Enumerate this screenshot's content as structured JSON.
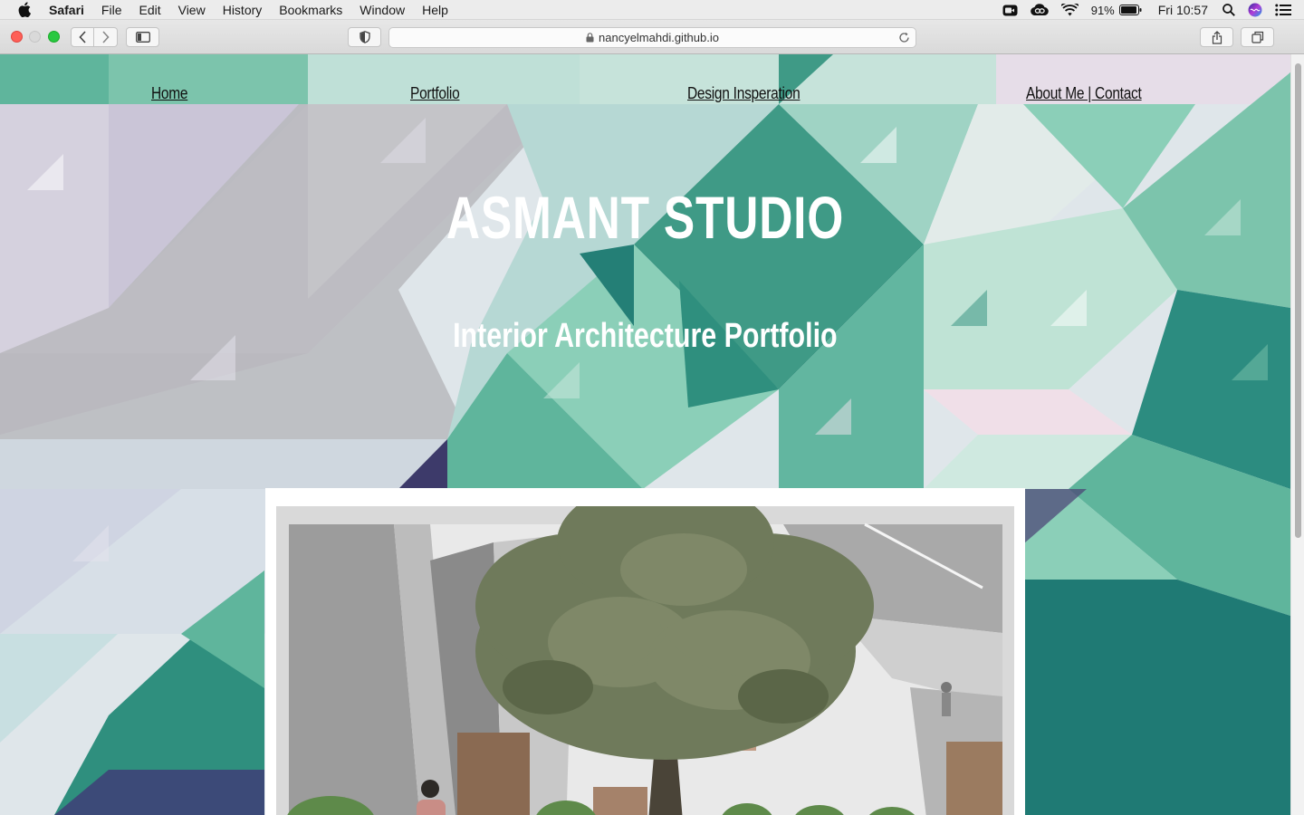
{
  "menubar": {
    "app_name": "Safari",
    "items": [
      "File",
      "Edit",
      "View",
      "History",
      "Bookmarks",
      "Window",
      "Help"
    ],
    "battery_percent": "91%",
    "clock": "Fri 10:57"
  },
  "toolbar": {
    "url": "nancyelmahdi.github.io"
  },
  "nav": {
    "home": "Home",
    "portfolio": "Portfolio",
    "design": "Design Insperation",
    "about": "About Me | Contact"
  },
  "hero": {
    "title": "ASMANT STUDIO",
    "subtitle": "Interior Architecture Portfolio"
  },
  "colors": {
    "teal_dark": "#1f7a74",
    "teal_mid": "#4fae97",
    "mint_light": "#a8dccb",
    "lavender": "#d4cde0",
    "grey": "#bdbdbd",
    "navy": "#3c4a78"
  }
}
